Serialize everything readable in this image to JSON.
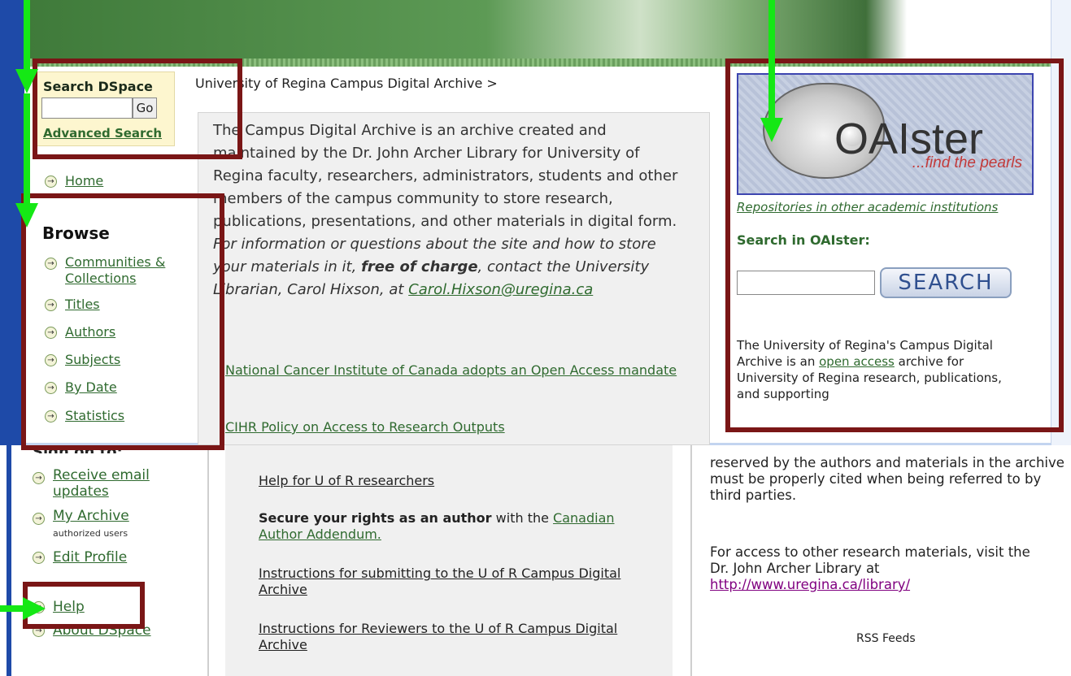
{
  "colors": {
    "accent": "#2f6a2f",
    "highlight_frame": "#7a1616",
    "annotation_arrow": "#15e815",
    "oaister_frame": "#3d45b0"
  },
  "search": {
    "title": "Search DSpace",
    "go": "Go",
    "advanced": "Advanced Search"
  },
  "nav": {
    "home": "Home"
  },
  "browse": {
    "heading": "Browse",
    "items": [
      "Communities & Collections",
      "Titles",
      "Authors",
      "Subjects",
      "By Date",
      "Statistics"
    ]
  },
  "breadcrumb": "University of Regina Campus Digital Archive >",
  "intro": {
    "plain": "The Campus Digital Archive is an archive created and maintained by the Dr. John Archer Library for University of Regina faculty, researchers, administrators, students and other members of the campus community to store research, publications, presentations, and other materials in digital form.",
    "italic_a": "For information or questions about the site and how to store your materials in it,",
    "bold": "free of charge",
    "italic_b": ", contact the University Librarian, Carol Hixson, at",
    "email": "Carol.Hixson@uregina.ca"
  },
  "links_top": [
    "National Cancer Institute of Canada adopts an Open Access mandate",
    "CIHR Policy on Access to Research Outputs"
  ],
  "oaister": {
    "logo": "OAIster",
    "tagline": "...find the pearls",
    "repo_link": "Repositories in other academic institutions",
    "search_heading": "Search in OAIster:",
    "search_button": "SEARCH"
  },
  "right_text": {
    "a": "The University of Regina's Campus Digital Archive is an",
    "link": "open access",
    "b": "archive for University of Regina research, publications, and supporting"
  },
  "signon": {
    "heading": "Sign on to:",
    "items": [
      {
        "label": "Receive email updates"
      },
      {
        "label": "My Archive",
        "sub": "authorized users"
      },
      {
        "label": "Edit Profile"
      }
    ]
  },
  "bottom_nav": [
    "Help",
    "About DSpace"
  ],
  "bottom_main": {
    "help": "Help for U of R researchers",
    "secure_bold": "Secure your rights as an author",
    "secure_plain": "with the",
    "addendum": "Canadian Author Addendum.",
    "instructions": "Instructions for submitting to the U of R Campus Digital Archive",
    "reviewers": "Instructions for Reviewers to the U of R Campus Digital Archive"
  },
  "bottom_right": {
    "rights": "reserved by the authors and materials in the archive must be properly cited when being referred to by third parties.",
    "access": "For access to other research materials, visit the Dr. John Archer Library at",
    "url": "http://www.uregina.ca/library/",
    "rss": "RSS Feeds"
  }
}
